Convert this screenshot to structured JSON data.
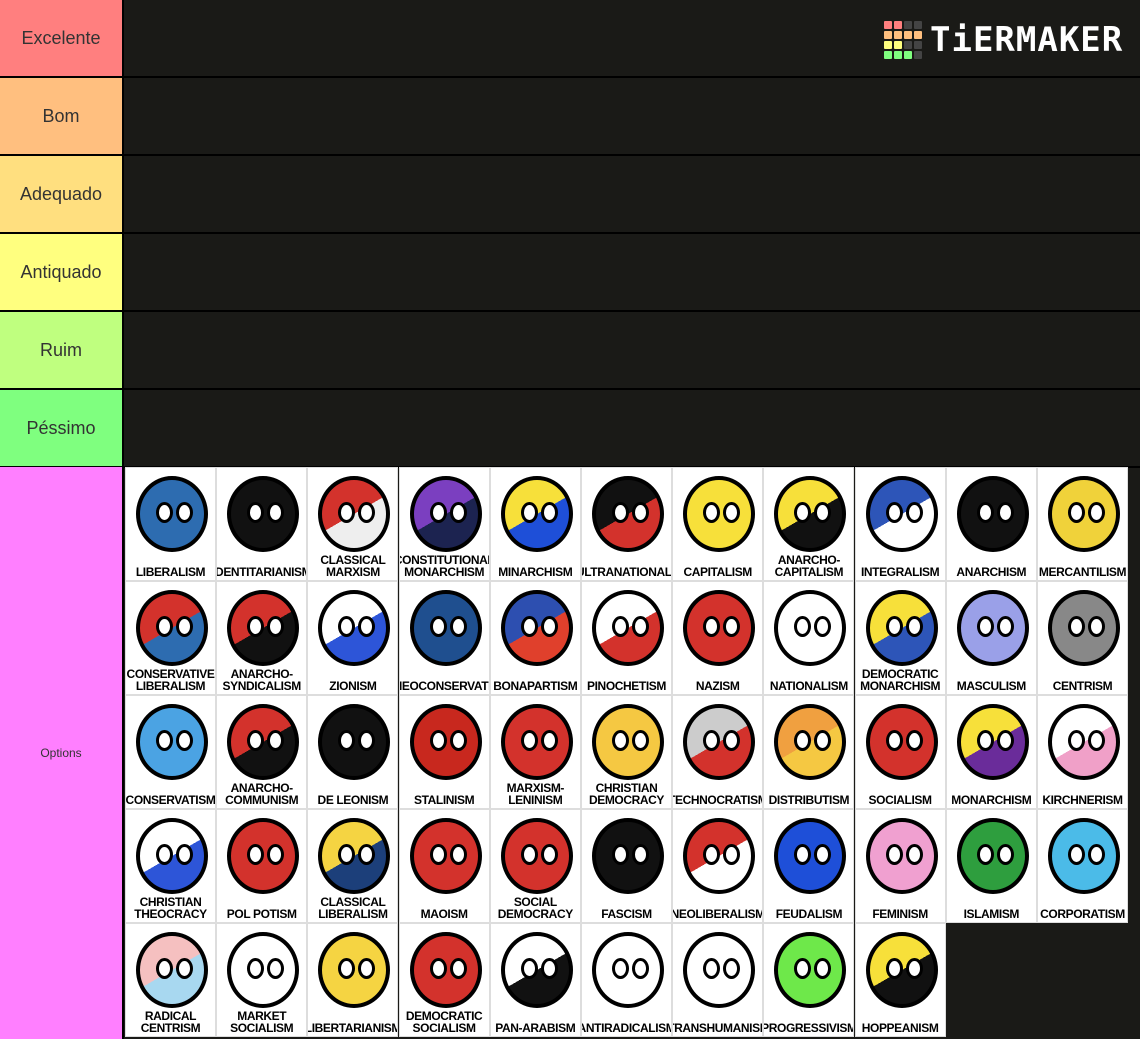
{
  "logo": {
    "text": "TiERMAKER",
    "grid_colors": [
      "#ff7f7f",
      "#ff7f7f",
      "#444",
      "#444",
      "#ffbf7f",
      "#ffbf7f",
      "#ffbf7f",
      "#ffbf7f",
      "#ffff7f",
      "#ffff7f",
      "#444",
      "#444",
      "#7fff7f",
      "#7fff7f",
      "#7fff7f",
      "#444"
    ]
  },
  "tiers": [
    {
      "label": "Excelente",
      "color": "#ff7f7f"
    },
    {
      "label": "Bom",
      "color": "#ffbf7f"
    },
    {
      "label": "Adequado",
      "color": "#ffdf7f"
    },
    {
      "label": "Antiquado",
      "color": "#ffff7f"
    },
    {
      "label": "Ruim",
      "color": "#bfff7f"
    },
    {
      "label": "Péssimo",
      "color": "#7fff7f"
    }
  ],
  "options": {
    "label": "Options",
    "color": "#ff7fff",
    "items": [
      {
        "label": "Liberalism",
        "c": [
          "#2d6cb0"
        ]
      },
      {
        "label": "Identitarianism",
        "c": [
          "#111"
        ]
      },
      {
        "label": "Classical\nMarxism",
        "c": [
          "#d3322c",
          "#eee"
        ]
      },
      {
        "label": "Constitutional\nMonarchism",
        "c": [
          "#7b3fc0",
          "#1c2350"
        ]
      },
      {
        "label": "Minarchism",
        "c": [
          "#f7e03a",
          "#1e4fd8"
        ]
      },
      {
        "label": "Ultranationalism",
        "c": [
          "#111",
          "#d3322c"
        ]
      },
      {
        "label": "Capitalism",
        "c": [
          "#f7e03a"
        ]
      },
      {
        "label": "Anarcho-\nCapitalism",
        "c": [
          "#f7e03a",
          "#111"
        ]
      },
      {
        "label": "Integralism",
        "c": [
          "#2d55b8",
          "#fff"
        ]
      },
      {
        "label": "Anarchism",
        "c": [
          "#111"
        ]
      },
      {
        "label": "Mercantilism",
        "c": [
          "#f0d23a"
        ]
      },
      {
        "label": "Conservative\nLiberalism",
        "c": [
          "#d3322c",
          "#2d6cb0"
        ]
      },
      {
        "label": "Anarcho-\nSyndicalism",
        "c": [
          "#d3322c",
          "#111"
        ]
      },
      {
        "label": "Zionism",
        "c": [
          "#fff",
          "#2d55d8"
        ]
      },
      {
        "label": "Neoconservatism",
        "c": [
          "#1f4f8f"
        ]
      },
      {
        "label": "Bonapartism",
        "c": [
          "#2d4fb0",
          "#e0402c"
        ]
      },
      {
        "label": "Pinochetism",
        "c": [
          "#fff",
          "#d3322c"
        ]
      },
      {
        "label": "Nazism",
        "c": [
          "#d3322c"
        ]
      },
      {
        "label": "Nationalism",
        "c": [
          "#fff"
        ]
      },
      {
        "label": "Democratic\nMonarchism",
        "c": [
          "#f7e03a",
          "#2d55b8"
        ]
      },
      {
        "label": "Masculism",
        "c": [
          "#9aa0e8"
        ]
      },
      {
        "label": "Centrism",
        "c": [
          "#888"
        ]
      },
      {
        "label": "Conservatism",
        "c": [
          "#4ba3e3"
        ]
      },
      {
        "label": "Anarcho-\nCommunism",
        "c": [
          "#d3322c",
          "#111"
        ]
      },
      {
        "label": "De Leonism",
        "c": [
          "#111"
        ]
      },
      {
        "label": "Stalinism",
        "c": [
          "#c8281e"
        ]
      },
      {
        "label": "Marxism-\nLeninism",
        "c": [
          "#d3322c"
        ]
      },
      {
        "label": "Christian\nDemocracy",
        "c": [
          "#f5c842"
        ]
      },
      {
        "label": "Technocratism",
        "c": [
          "#ccc",
          "#d3322c"
        ]
      },
      {
        "label": "Distributism",
        "c": [
          "#f0a040",
          "#f5c842"
        ]
      },
      {
        "label": "Socialism",
        "c": [
          "#d3322c"
        ]
      },
      {
        "label": "Monarchism",
        "c": [
          "#f7e03a",
          "#6a2c9a"
        ]
      },
      {
        "label": "Kirchnerism",
        "c": [
          "#fff",
          "#f0a0c8"
        ]
      },
      {
        "label": "Christian\nTheocracy",
        "c": [
          "#fff",
          "#2d55d8"
        ]
      },
      {
        "label": "Pol Potism",
        "c": [
          "#d3322c"
        ]
      },
      {
        "label": "Classical\nLiberalism",
        "c": [
          "#f5d442",
          "#1c3f7a"
        ]
      },
      {
        "label": "Maoism",
        "c": [
          "#d3322c"
        ]
      },
      {
        "label": "Social\nDemocracy",
        "c": [
          "#d3322c"
        ]
      },
      {
        "label": "Fascism",
        "c": [
          "#111"
        ]
      },
      {
        "label": "Neoliberalism",
        "c": [
          "#d3322c",
          "#fff"
        ]
      },
      {
        "label": "Feudalism",
        "c": [
          "#1e4fd8"
        ]
      },
      {
        "label": "Feminism",
        "c": [
          "#f0a0d0"
        ]
      },
      {
        "label": "Islamism",
        "c": [
          "#2e9e3e"
        ]
      },
      {
        "label": "Corporatism",
        "c": [
          "#4bbbe8"
        ]
      },
      {
        "label": "Radical\nCentrism",
        "c": [
          "#f5c0c0",
          "#a8d8f0"
        ]
      },
      {
        "label": "Market\nSocialism",
        "c": [
          "#fff"
        ]
      },
      {
        "label": "Libertarianism",
        "c": [
          "#f5d442"
        ]
      },
      {
        "label": "Democratic\nSocialism",
        "c": [
          "#d3322c"
        ]
      },
      {
        "label": "Pan-Arabism",
        "c": [
          "#fff",
          "#111"
        ]
      },
      {
        "label": "Antiradicalism",
        "c": [
          "#fff"
        ]
      },
      {
        "label": "Transhumanism",
        "c": [
          "#fff"
        ]
      },
      {
        "label": "Progressivism",
        "c": [
          "#6ee84a"
        ]
      },
      {
        "label": "Hoppeanism",
        "c": [
          "#f7e03a",
          "#111"
        ]
      }
    ]
  }
}
